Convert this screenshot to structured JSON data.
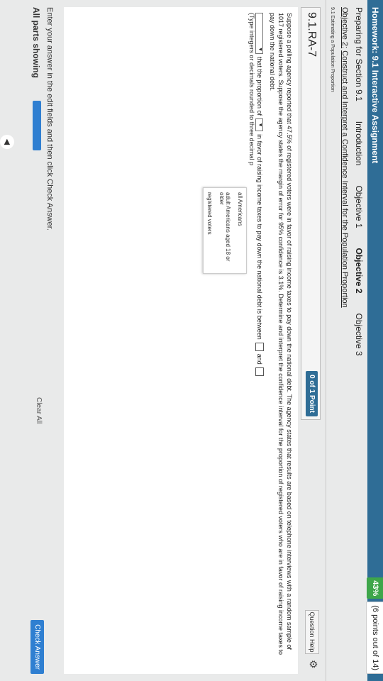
{
  "header": {
    "title": "Homework: 9.1 Interactive Assignment",
    "score_percent": "43%",
    "score_points": "(6 points out of 14)"
  },
  "nav": {
    "items": [
      "Preparing for Section 9.1",
      "Introduction",
      "Objective 1",
      "Objective 2",
      "Objective 3"
    ],
    "active": "Objective 2"
  },
  "objective": {
    "label": "Objective 2:",
    "text": "Construct and Interpret a Confidence Interval for the Population Proportion"
  },
  "section": {
    "text": "9.1 Estimating a Population Proportion"
  },
  "question": {
    "id": "9.1.RA-7",
    "points": "0 of 1 Point",
    "help": "Question Help",
    "text": "Suppose a polling agency reported that 47.5% of registered voters were in favor of raising income taxes to pay down the national debt. The agency states that results are based on telephone interviews with a random sample of 1017 registered voters. Suppose the agency states the margin of error for 95% confidence is 3.1%. Determine and interpret the confidence interval for the proportion of registered voters who are in favor of raising income taxes to pay down the national debt.",
    "answer_prefix": "that the proportion of",
    "answer_suffix": "in favor of raising income taxes to pay down the national debt is between",
    "and_word": "and",
    "hint": "(Type integers or decimals rounded to three decimal p",
    "dropdown_options": [
      "all Americans",
      "adult Americans aged 18 or older",
      "registered voters"
    ]
  },
  "footer": {
    "instruction": "Enter your answer in the edit fields and then click Check Answer.",
    "parts": "All parts showing",
    "clear": "Clear All",
    "check": "Check Answer"
  },
  "colors": {
    "titlebar": "#2f6d96",
    "score": "#3ea64a",
    "accent": "#2f7fd1"
  }
}
